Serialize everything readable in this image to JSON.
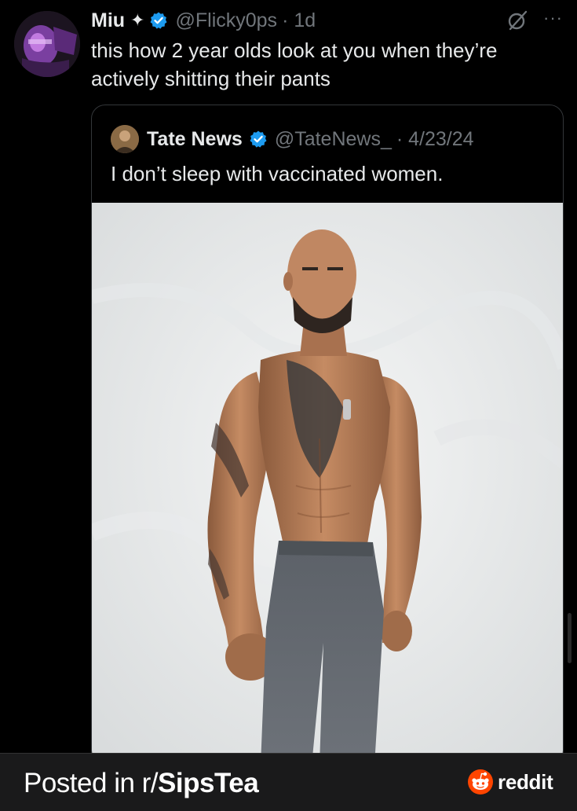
{
  "tweet": {
    "display_name": "Miu",
    "sparkle_glyph": "✦",
    "handle": "@Flicky0ps",
    "time": "· 1d",
    "text": "this how 2 year olds look at you when they’re actively shitting their pants",
    "more_glyph": "···"
  },
  "quoted_tweet": {
    "display_name": "Tate News",
    "handle": "@TateNews_",
    "date": "· 4/23/24",
    "text": "I don’t sleep with vaccinated women."
  },
  "footer": {
    "posted_prefix": "Posted in r/",
    "subreddit": "SipsTea",
    "brand": "reddit"
  },
  "colors": {
    "background": "#000000",
    "text_primary": "#e7e9ea",
    "text_secondary": "#71767b",
    "verified_blue": "#1d9bf0",
    "reddit_orange": "#ff4500",
    "footer_bg": "#1a1a1b"
  },
  "icons": [
    "verified-badge-icon",
    "grok-icon",
    "more-icon",
    "reddit-snoo-icon"
  ]
}
